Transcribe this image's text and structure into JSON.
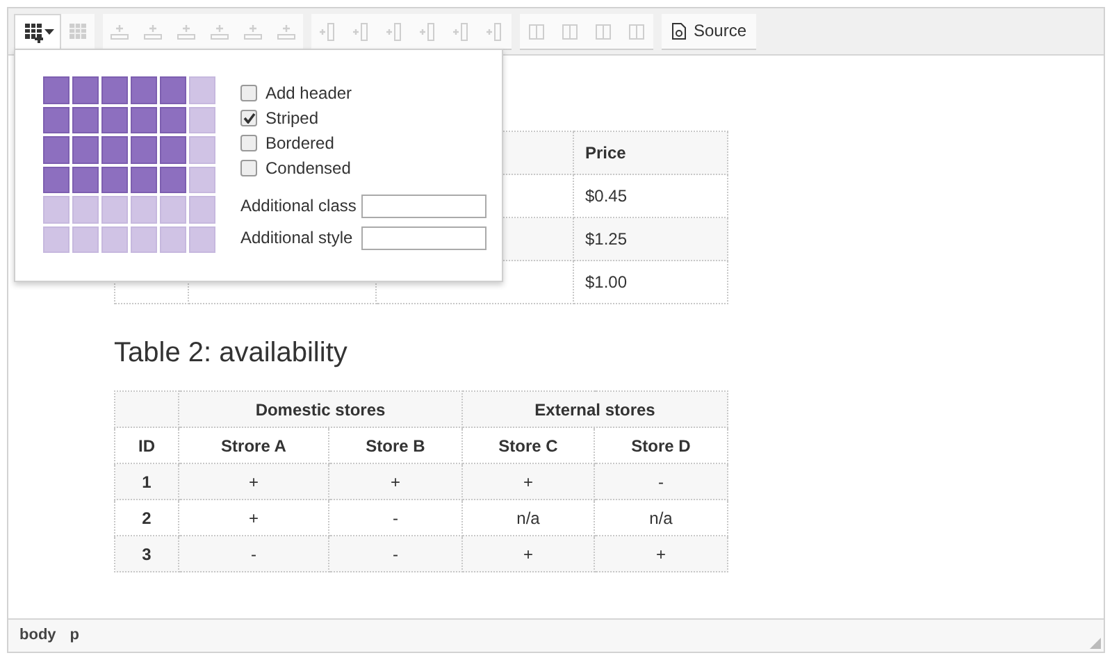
{
  "toolbar": {
    "groups": [
      {
        "buttons": [
          {
            "kind": "table-insert",
            "disabled": false,
            "expanded": true
          },
          {
            "kind": "table-props",
            "disabled": true,
            "expanded": false
          }
        ]
      },
      {
        "buttons": [
          {
            "kind": "row-above",
            "disabled": true,
            "expanded": false
          },
          {
            "kind": "row-below",
            "disabled": true,
            "expanded": false
          },
          {
            "kind": "row-props",
            "disabled": true,
            "expanded": false
          },
          {
            "kind": "row-cut",
            "disabled": true,
            "expanded": false
          },
          {
            "kind": "row-paste",
            "disabled": true,
            "expanded": false
          },
          {
            "kind": "row-delete",
            "disabled": true,
            "expanded": false
          }
        ]
      },
      {
        "buttons": [
          {
            "kind": "col-before",
            "disabled": true,
            "expanded": false
          },
          {
            "kind": "col-after",
            "disabled": true,
            "expanded": false
          },
          {
            "kind": "col-props",
            "disabled": true,
            "expanded": false
          },
          {
            "kind": "col-cut",
            "disabled": true,
            "expanded": false
          },
          {
            "kind": "col-paste",
            "disabled": true,
            "expanded": false
          },
          {
            "kind": "col-delete",
            "disabled": true,
            "expanded": false
          }
        ]
      },
      {
        "buttons": [
          {
            "kind": "cell-props",
            "disabled": true,
            "expanded": false
          },
          {
            "kind": "cell-merge",
            "disabled": true,
            "expanded": false
          },
          {
            "kind": "cell-split",
            "disabled": true,
            "expanded": false
          },
          {
            "kind": "cell-grid",
            "disabled": true,
            "expanded": false
          }
        ]
      }
    ],
    "source_button": {
      "label": "Source"
    }
  },
  "table_popup": {
    "grid": [
      {
        "cells": [
          {
            "selected": true
          },
          {
            "selected": true
          },
          {
            "selected": true
          },
          {
            "selected": true
          },
          {
            "selected": true
          },
          {
            "selected": false
          }
        ]
      },
      {
        "cells": [
          {
            "selected": true
          },
          {
            "selected": true
          },
          {
            "selected": true
          },
          {
            "selected": true
          },
          {
            "selected": true
          },
          {
            "selected": false
          }
        ]
      },
      {
        "cells": [
          {
            "selected": true
          },
          {
            "selected": true
          },
          {
            "selected": true
          },
          {
            "selected": true
          },
          {
            "selected": true
          },
          {
            "selected": false
          }
        ]
      },
      {
        "cells": [
          {
            "selected": true
          },
          {
            "selected": true
          },
          {
            "selected": true
          },
          {
            "selected": true
          },
          {
            "selected": true
          },
          {
            "selected": false
          }
        ]
      },
      {
        "cells": [
          {
            "selected": false
          },
          {
            "selected": false
          },
          {
            "selected": false
          },
          {
            "selected": false
          },
          {
            "selected": false
          },
          {
            "selected": false
          }
        ]
      },
      {
        "cells": [
          {
            "selected": false
          },
          {
            "selected": false
          },
          {
            "selected": false
          },
          {
            "selected": false
          },
          {
            "selected": false
          },
          {
            "selected": false
          }
        ]
      }
    ],
    "options": [
      {
        "label": "Add header",
        "checked": false
      },
      {
        "label": "Striped",
        "checked": true
      },
      {
        "label": "Bordered",
        "checked": false
      },
      {
        "label": "Condensed",
        "checked": false
      }
    ],
    "fields": [
      {
        "label": "Additional class"
      },
      {
        "label": "Additional style"
      }
    ]
  },
  "table_1": {
    "header": [
      "Price"
    ],
    "rows": [
      {
        "cells": [
          "$0.45"
        ]
      },
      {
        "cells": [
          "$1.25"
        ]
      },
      {
        "cells": [
          "$1.00"
        ]
      }
    ]
  },
  "table_2": {
    "heading": "Table 2: availability",
    "group_header": [
      "Domestic stores",
      "External stores"
    ],
    "columns": [
      "ID",
      "Strore A",
      "Store B",
      "Store C",
      "Store D"
    ],
    "rows": [
      {
        "cells": [
          "1",
          "+",
          "+",
          "+",
          "-"
        ]
      },
      {
        "cells": [
          "2",
          "+",
          "-",
          "n/a",
          "n/a"
        ]
      },
      {
        "cells": [
          "3",
          "-",
          "-",
          "+",
          "+"
        ]
      }
    ]
  },
  "status_bar": {
    "path": [
      "body",
      "p"
    ]
  }
}
